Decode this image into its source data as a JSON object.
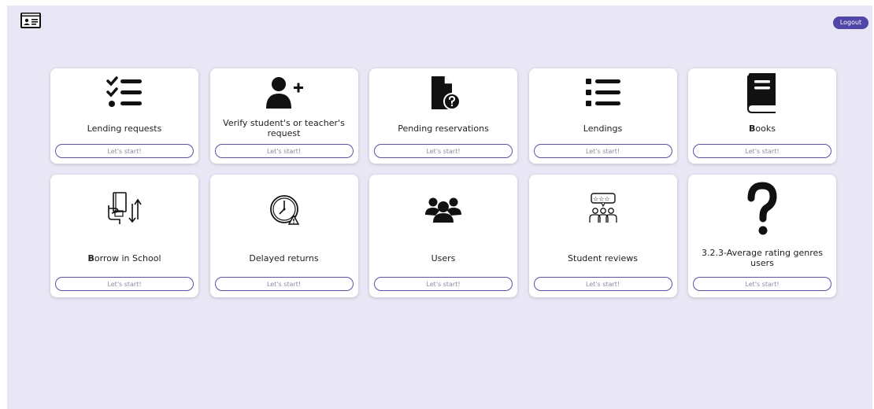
{
  "header": {
    "logo_icon": "id-card-icon",
    "logout_label": "Logout",
    "accent_color": "#5046a8"
  },
  "cards": [
    {
      "name": "lending-requests",
      "icon": "checklist-icon",
      "label": "Lending requests",
      "button": "Let's start!"
    },
    {
      "name": "verify-requests",
      "icon": "user-plus-icon",
      "label": "Verify student's or teacher's request",
      "button": "Let's start!"
    },
    {
      "name": "pending-reservations",
      "icon": "file-question-icon",
      "label": "Pending reservations",
      "button": "Let's start!"
    },
    {
      "name": "lendings",
      "icon": "list-icon",
      "label": "Lendings",
      "button": "Let's start!"
    },
    {
      "name": "books",
      "icon": "book-icon",
      "label_bold": "B",
      "label_rest": "ooks",
      "button": "Let's start!"
    },
    {
      "name": "borrow-in-school",
      "icon": "borrow-book-icon",
      "label_bold": "B",
      "label_rest": "orrow in School",
      "button": "Let's start!"
    },
    {
      "name": "delayed-returns",
      "icon": "clock-warning-icon",
      "label": "Delayed returns",
      "button": "Let's start!"
    },
    {
      "name": "users",
      "icon": "users-group-icon",
      "label": "Users",
      "button": "Let's start!"
    },
    {
      "name": "student-reviews",
      "icon": "rating-reviews-icon",
      "label": "Student reviews",
      "button": "Let's start!"
    },
    {
      "name": "average-rating-genres",
      "icon": "question-mark-icon",
      "label": "3.2.3-Average rating genres users",
      "button": "Let's start!"
    }
  ]
}
